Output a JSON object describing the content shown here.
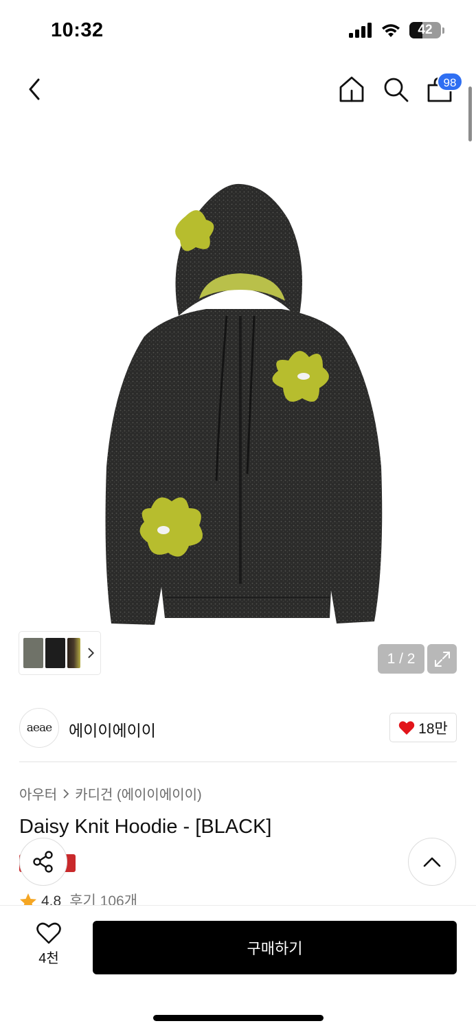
{
  "status_bar": {
    "time": "10:32",
    "battery": "42",
    "battery_level_percent": 42
  },
  "nav": {
    "cart_count": "98"
  },
  "gallery": {
    "page_counter": "1 / 2"
  },
  "brand": {
    "logo_text": "aeae",
    "name": "에이이에이이",
    "like_count": "18만"
  },
  "product": {
    "breadcrumb": [
      "아우터",
      "카디건 (에이이에이이)"
    ],
    "title": "Daisy Knit Hoodie - [BLACK]",
    "rating": "4.8",
    "review_text": "후기 106개"
  },
  "bottom": {
    "wish_count": "4천",
    "buy_label": "구매하기"
  },
  "colors": {
    "accent_blue": "#2f6ff2",
    "heart_red": "#e2141a",
    "sale_red": "#c9292b",
    "star": "#f5a623"
  },
  "icons": [
    "back-icon",
    "home-icon",
    "search-icon",
    "cart-icon",
    "expand-icon",
    "heart-icon",
    "share-icon",
    "chevron-up-icon",
    "star-icon"
  ]
}
